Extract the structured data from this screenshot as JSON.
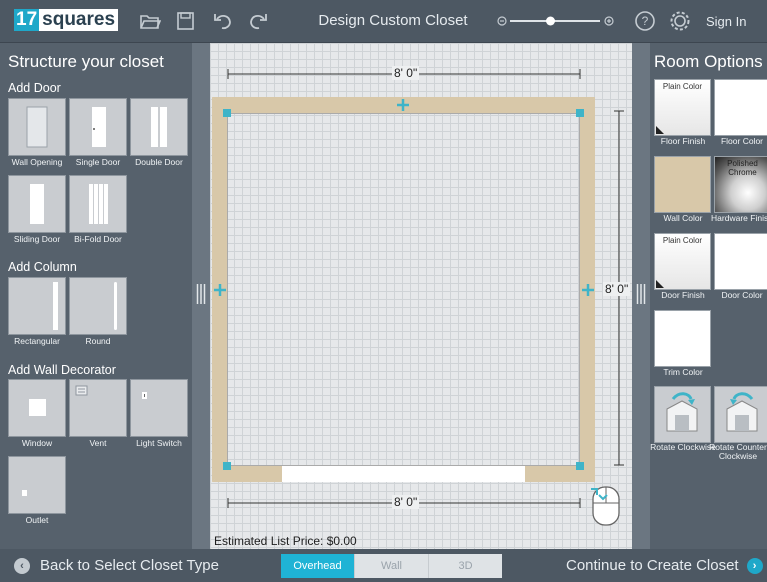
{
  "header": {
    "logo_number": "17",
    "logo_word": "squares",
    "title": "Design Custom Closet",
    "signin": "Sign In",
    "zoom_level": 0.45
  },
  "left": {
    "title": "Structure your closet",
    "sections": {
      "doors": "Add Door",
      "columns": "Add Column",
      "decor": "Add Wall Decorator"
    },
    "doors": [
      "Wall Opening",
      "Single Door",
      "Double Door",
      "Sliding Door",
      "Bi-Fold Door"
    ],
    "columns": [
      "Rectangular",
      "Round"
    ],
    "decor": [
      "Window",
      "Vent",
      "Light Switch",
      "Outlet"
    ]
  },
  "canvas": {
    "top_dim": "8' 0\"",
    "right_dim": "8' 0\"",
    "bottom_dim": "8' 0\"",
    "price": "Estimated List Price: $0.00"
  },
  "right": {
    "title": "Room Options",
    "plain_color": "Plain Color",
    "polished_chrome": "Polished Chrome",
    "floor_finish": "Floor Finish",
    "floor_color": "Floor Color",
    "wall_color": "Wall Color",
    "hardware_finish": "Hardware Finish",
    "door_finish": "Door Finish",
    "door_color": "Door Color",
    "trim_color": "Trim Color",
    "rotate_cw": "Rotate Clockwise",
    "rotate_ccw": "Rotate Counter Clockwise",
    "wall_color_hex": "#d8c8a9"
  },
  "bottom": {
    "back": "Back to Select Closet Type",
    "views": [
      "Overhead",
      "Wall",
      "3D"
    ],
    "active_view": "Overhead",
    "continue": "Continue to Create Closet"
  }
}
